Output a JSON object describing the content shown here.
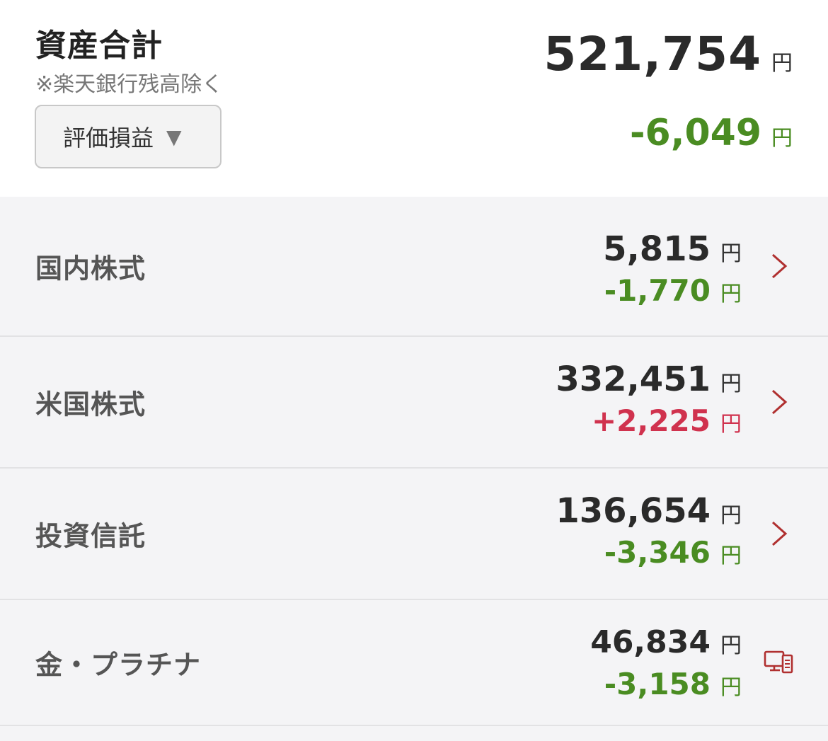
{
  "summary": {
    "title": "資産合計",
    "note": "※楽天銀行残高除く",
    "mode_select": {
      "label": "評価損益",
      "arrow": "▼"
    },
    "total_value": "521,754",
    "total_unit": "円",
    "total_pl": "-6,049",
    "total_pl_unit": "円"
  },
  "colors": {
    "profit": "#d0324e",
    "loss": "#4a8c22",
    "chevron": "#b03030"
  },
  "assets": [
    {
      "label": "国内株式",
      "value": "5,815",
      "value_unit": "円",
      "pl": "-1,770",
      "pl_unit": "円",
      "icon": "chevron-right-icon"
    },
    {
      "label": "米国株式",
      "value": "332,451",
      "value_unit": "円",
      "pl": "+2,225",
      "pl_unit": "円",
      "icon": "chevron-right-icon"
    },
    {
      "label": "投資信託",
      "value": "136,654",
      "value_unit": "円",
      "pl": "-3,346",
      "pl_unit": "円",
      "icon": "chevron-right-icon"
    },
    {
      "label": "金・プラチナ",
      "value": "46,834",
      "value_unit": "円",
      "pl": "-3,158",
      "pl_unit": "円",
      "icon": "pc-terminal-icon"
    }
  ]
}
